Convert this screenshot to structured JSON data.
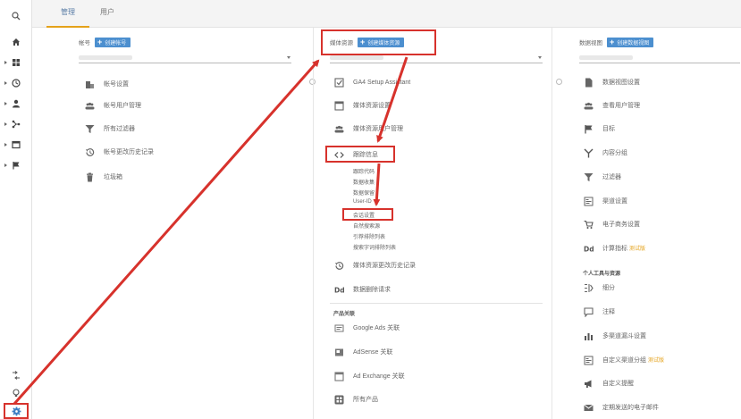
{
  "tabs": [
    {
      "label": "管理"
    },
    {
      "label": "用户"
    }
  ],
  "account": {
    "header_label": "帐号",
    "create_label": "创建帐号",
    "items": [
      {
        "label": "帐号设置",
        "icon": "building-icon"
      },
      {
        "label": "帐号用户管理",
        "icon": "people-icon"
      },
      {
        "label": "所有过滤器",
        "icon": "filter-icon"
      },
      {
        "label": "帐号更改历史记录",
        "icon": "history-icon"
      },
      {
        "label": "垃圾箱",
        "icon": "trash-icon"
      }
    ]
  },
  "property": {
    "header_label": "媒体资源",
    "create_label": "创建媒体资源",
    "items_top": [
      {
        "label": "GA4 Setup Assistant",
        "icon": "checkbox-icon"
      },
      {
        "label": "媒体资源设置",
        "icon": "window-icon"
      },
      {
        "label": "媒体资源用户管理",
        "icon": "people-icon"
      }
    ],
    "tracking": {
      "label": "跟踪信息",
      "icon": "code-icon"
    },
    "tracking_sub": [
      "跟踪代码",
      "数据收集",
      "数据保留",
      "User-ID",
      "会话设置",
      "自然搜索源",
      "引荐排除列表",
      "搜索字词排除列表"
    ],
    "items_bottom": [
      {
        "label": "媒体资源更改历史记录",
        "icon": "history-icon"
      },
      {
        "label": "数据删除请求",
        "icon": "dd-icon"
      }
    ],
    "product_section": "产品关联",
    "products": [
      {
        "label": "Google Ads 关联",
        "icon": "ads-icon"
      },
      {
        "label": "AdSense 关联",
        "icon": "adsense-icon"
      },
      {
        "label": "Ad Exchange 关联",
        "icon": "adx-icon"
      },
      {
        "label": "所有产品",
        "icon": "grid-icon"
      }
    ]
  },
  "view": {
    "header_label": "数据视图",
    "create_label": "创建数据视图",
    "items": [
      {
        "label": "数据视图设置",
        "icon": "document-icon"
      },
      {
        "label": "查看用户管理",
        "icon": "people-icon"
      },
      {
        "label": "目标",
        "icon": "flag-icon"
      },
      {
        "label": "内容分组",
        "icon": "walk-icon"
      },
      {
        "label": "过滤器",
        "icon": "filter-icon"
      },
      {
        "label": "渠道设置",
        "icon": "channel-icon"
      },
      {
        "label": "电子商务设置",
        "icon": "cart-icon"
      },
      {
        "label": "计算指标",
        "icon": "dd-icon",
        "badge": "测试版"
      }
    ],
    "personal_section": "个人工具与资源",
    "personal": [
      {
        "label": "细分",
        "icon": "segment-icon"
      },
      {
        "label": "注释",
        "icon": "comment-icon"
      },
      {
        "label": "多渠道漏斗设置",
        "icon": "bars-icon"
      },
      {
        "label": "自定义渠道分组",
        "icon": "channel-icon",
        "badge": "测试版"
      },
      {
        "label": "自定义提醒",
        "icon": "megaphone-icon"
      },
      {
        "label": "定期发送的电子邮件",
        "icon": "mail-icon"
      }
    ]
  },
  "colors": {
    "accent": "#4c8fcf",
    "highlight": "#d7322c",
    "tab_underline": "#e4a21a"
  }
}
